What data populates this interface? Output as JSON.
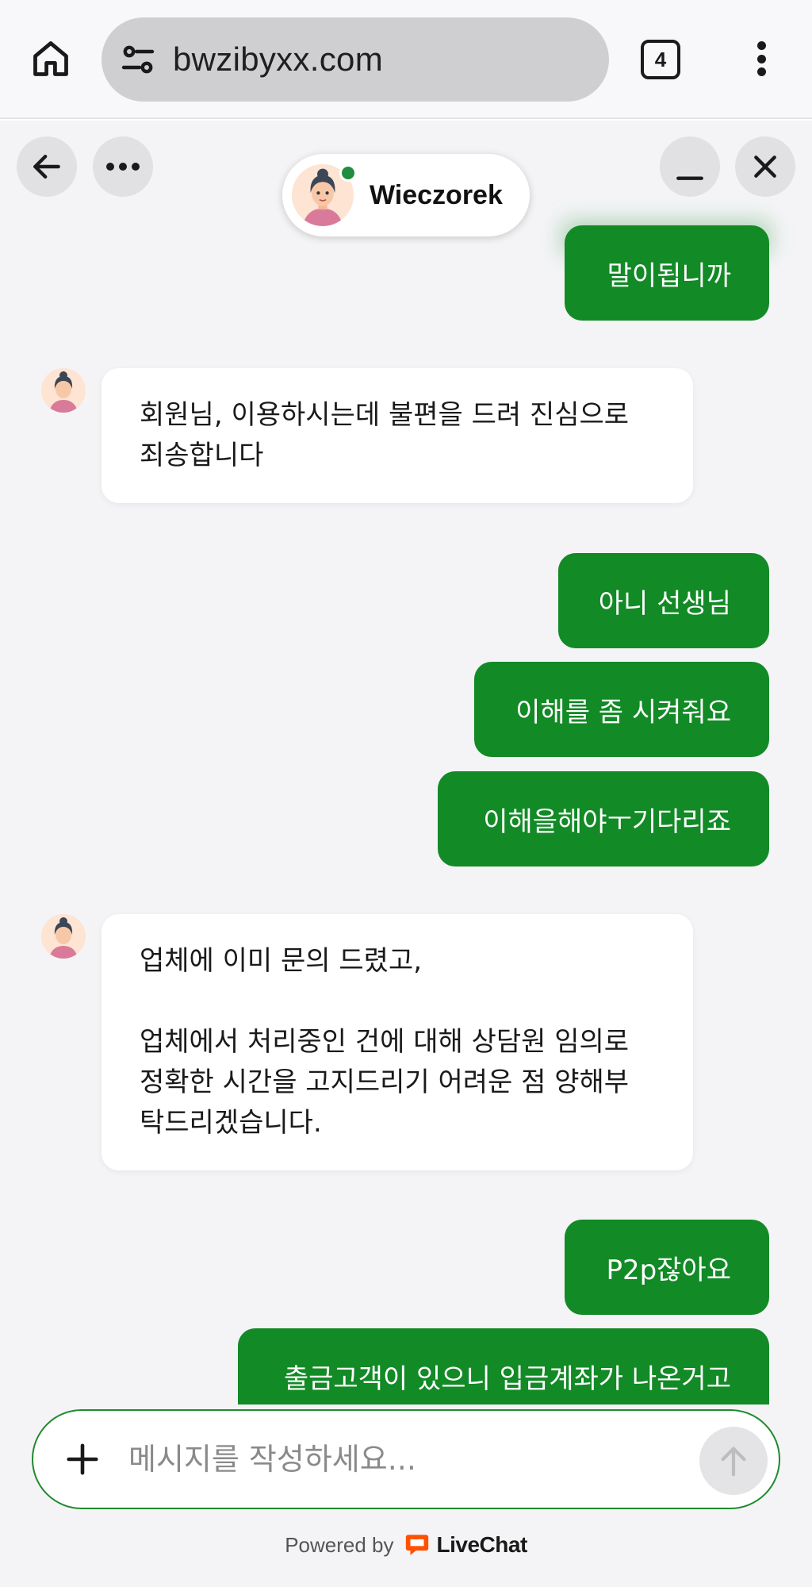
{
  "browser": {
    "url": "bwzibyxx.com",
    "tab_count": "4",
    "icons": {
      "home": "home-icon",
      "site_settings": "tune-icon",
      "tabs": "tabs-icon",
      "menu": "more-vert-icon"
    }
  },
  "chat": {
    "agent_name": "Wieczorek",
    "agent_status_color": "#1e8e3e",
    "icons": {
      "back": "arrow-left-icon",
      "more": "more-horiz-icon",
      "minimize": "minimize-icon",
      "close": "close-icon"
    },
    "messages": [
      {
        "from": "customer",
        "text": "말이됩니까"
      },
      {
        "from": "agent",
        "lines": [
          "회원님, 이용하시는데 불편을 드려 진심으로",
          "죄송합니다"
        ]
      },
      {
        "from": "customer",
        "text": "아니 선생님"
      },
      {
        "from": "customer",
        "text": "이해를 좀 시켜줘요"
      },
      {
        "from": "customer",
        "text": "이해을해야ㅜ기다리죠"
      },
      {
        "from": "agent",
        "lines": [
          "업체에 이미 문의 드렸고,",
          "",
          "업체에서 처리중인 건에 대해 상담원 임의로",
          "정확한 시간을 고지드리기 어려운 점 양해부",
          "탁드리겠습니다."
        ]
      },
      {
        "from": "customer",
        "text": "P2p잖아요"
      },
      {
        "from": "customer",
        "text": "출금고객이 있으니 입금계좌가 나온거고"
      }
    ]
  },
  "composer": {
    "placeholder": "메시지를 작성하세요...",
    "value": "",
    "icons": {
      "attach": "plus-icon",
      "send": "arrow-up-icon"
    }
  },
  "footer": {
    "powered_by": "Powered by",
    "brand": "LiveChat",
    "brand_color": "#ff5100"
  },
  "colors": {
    "customer_bubble": "#128a26",
    "agent_bubble": "#ffffff",
    "chat_background": "#f4f4f6",
    "composer_border": "#1f8a2e"
  }
}
